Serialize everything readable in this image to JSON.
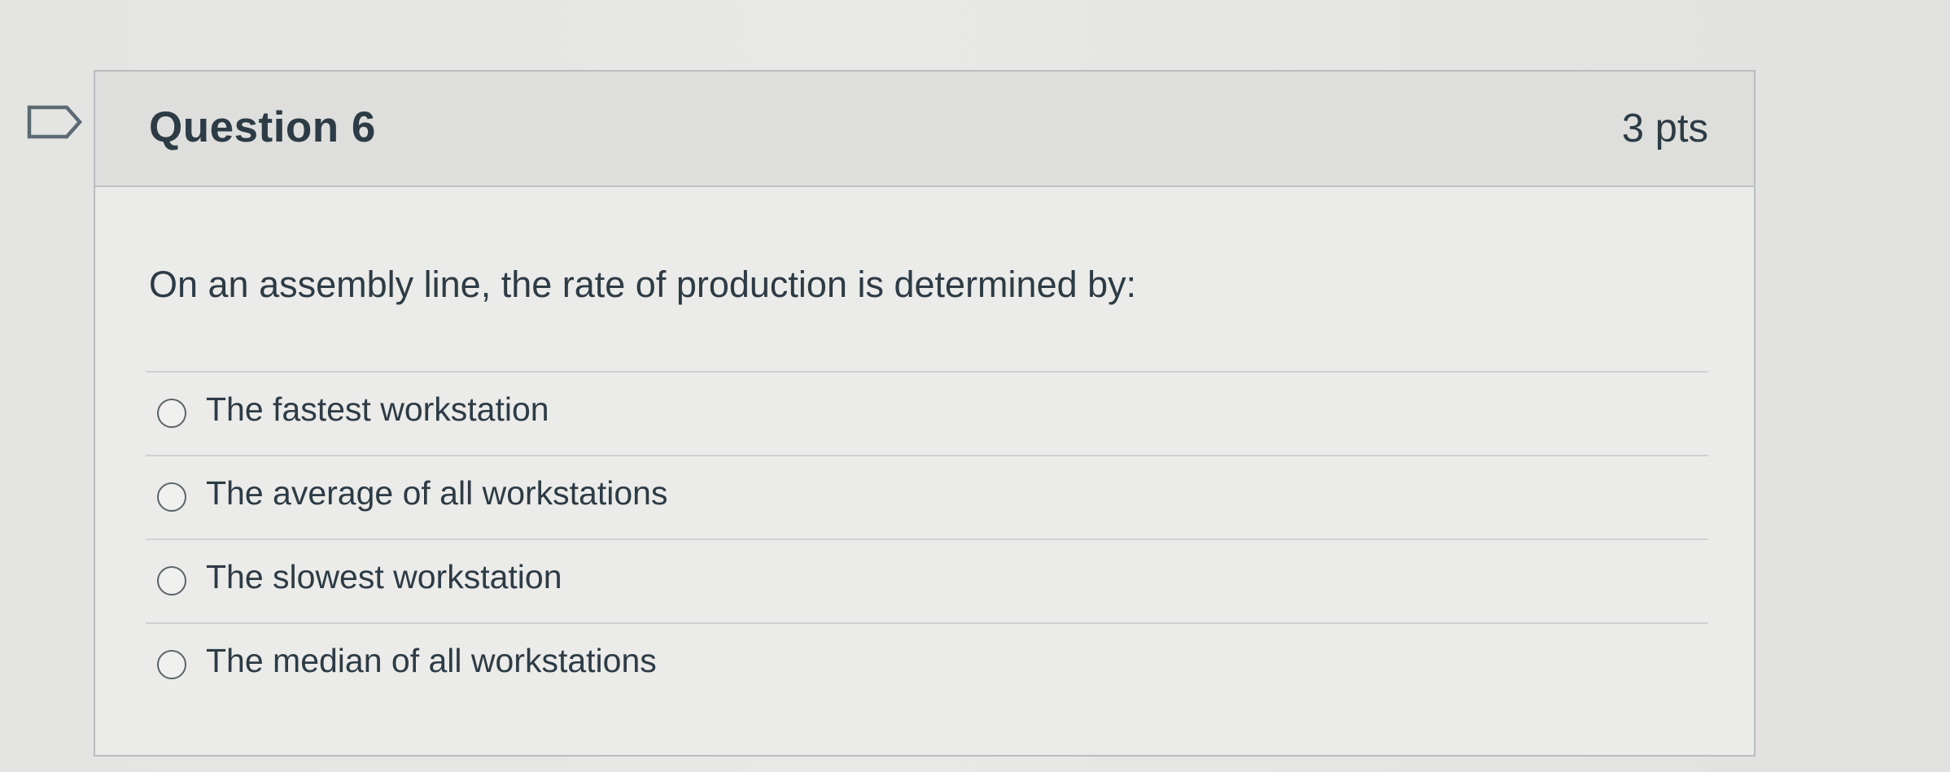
{
  "question": {
    "title": "Question 6",
    "points": "3 pts",
    "text": "On an assembly line, the rate of production is determined by:",
    "flag_icon": "flag-outline-icon"
  },
  "answers": [
    {
      "label": "The fastest workstation",
      "selected": false
    },
    {
      "label": "The average of all workstations",
      "selected": false
    },
    {
      "label": "The slowest workstation",
      "selected": false
    },
    {
      "label": "The median of all workstations",
      "selected": false
    }
  ],
  "colors": {
    "text": "#2d3b45",
    "header_bg": "#dedfdd",
    "card_bg": "#ebebe9",
    "border": "#b9bdbe"
  }
}
